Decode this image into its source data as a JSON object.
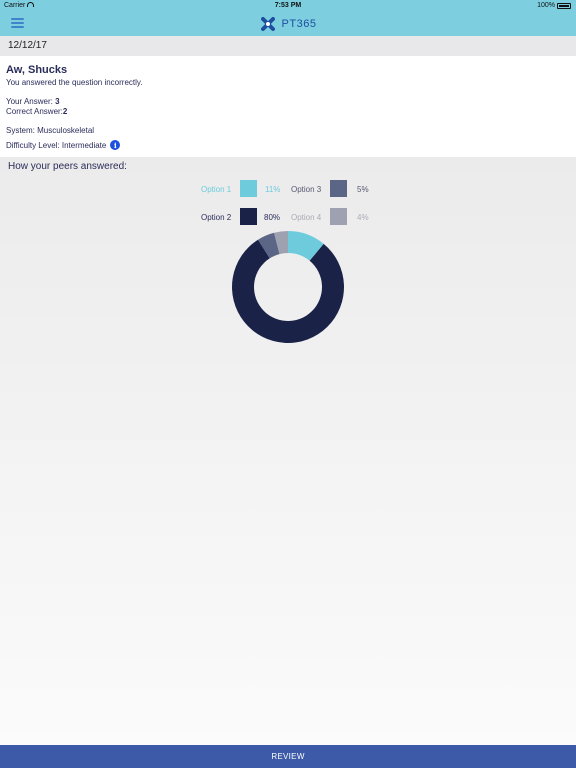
{
  "status_bar": {
    "carrier": "Carrier",
    "time": "7:53 PM",
    "battery": "100%"
  },
  "nav": {
    "app_name": "PT365",
    "icons": {
      "menu": "hamburger-menu-icon",
      "logo": "pt365-x-logo-icon"
    }
  },
  "date": "12/12/17",
  "result": {
    "title": "Aw, Shucks",
    "message": "You answered the question incorrectly.",
    "your_answer_label": "Your Answer: ",
    "your_answer_value": "3",
    "correct_answer_label": "Correct Answer:",
    "correct_answer_value": "2",
    "system_label": "System: ",
    "system_value": "Musculoskeletal",
    "difficulty_label": "Difficulty Level: ",
    "difficulty_value": "Intermediate",
    "info_icon": "info-icon"
  },
  "peers": {
    "heading": "How your peers answered:",
    "options": [
      {
        "label": "Option 1",
        "percent": "11%",
        "value": 11,
        "color": "#6ecbdc",
        "text_color": "#6ecbdc"
      },
      {
        "label": "Option 2",
        "percent": "80%",
        "value": 80,
        "color": "#1a2347",
        "text_color": "#2a2d5a"
      },
      {
        "label": "Option 3",
        "percent": "5%",
        "value": 5,
        "color": "#5b6585",
        "text_color": "#555a70"
      },
      {
        "label": "Option 4",
        "percent": "4%",
        "value": 4,
        "color": "#9ea1b0",
        "text_color": "#aaaab6"
      }
    ]
  },
  "footer": {
    "review_label": "REVIEW"
  },
  "colors": {
    "header": "#7dcfe0",
    "footer": "#3d5aa8",
    "text": "#2a2d5a"
  }
}
